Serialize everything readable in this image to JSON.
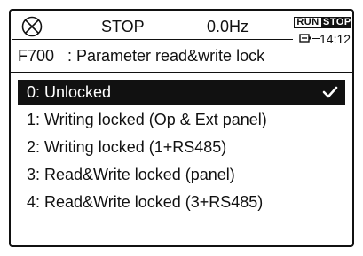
{
  "status": {
    "mode": "STOP",
    "frequency": "0.0Hz",
    "run_label": "RUN",
    "stop_label": "STOP",
    "time": "14:12"
  },
  "parameter": {
    "code": "F700",
    "title": ": Parameter read&write lock"
  },
  "options": [
    {
      "label": "0: Unlocked",
      "selected": true
    },
    {
      "label": "1: Writing locked (Op & Ext panel)",
      "selected": false
    },
    {
      "label": "2: Writing locked (1+RS485)",
      "selected": false
    },
    {
      "label": "3: Read&Write locked (panel)",
      "selected": false
    },
    {
      "label": "4: Read&Write locked (3+RS485)",
      "selected": false
    }
  ],
  "icons": {
    "status": "stop-circle-x-icon",
    "clock": "battery-clock-icon",
    "selected": "checkmark-icon"
  }
}
